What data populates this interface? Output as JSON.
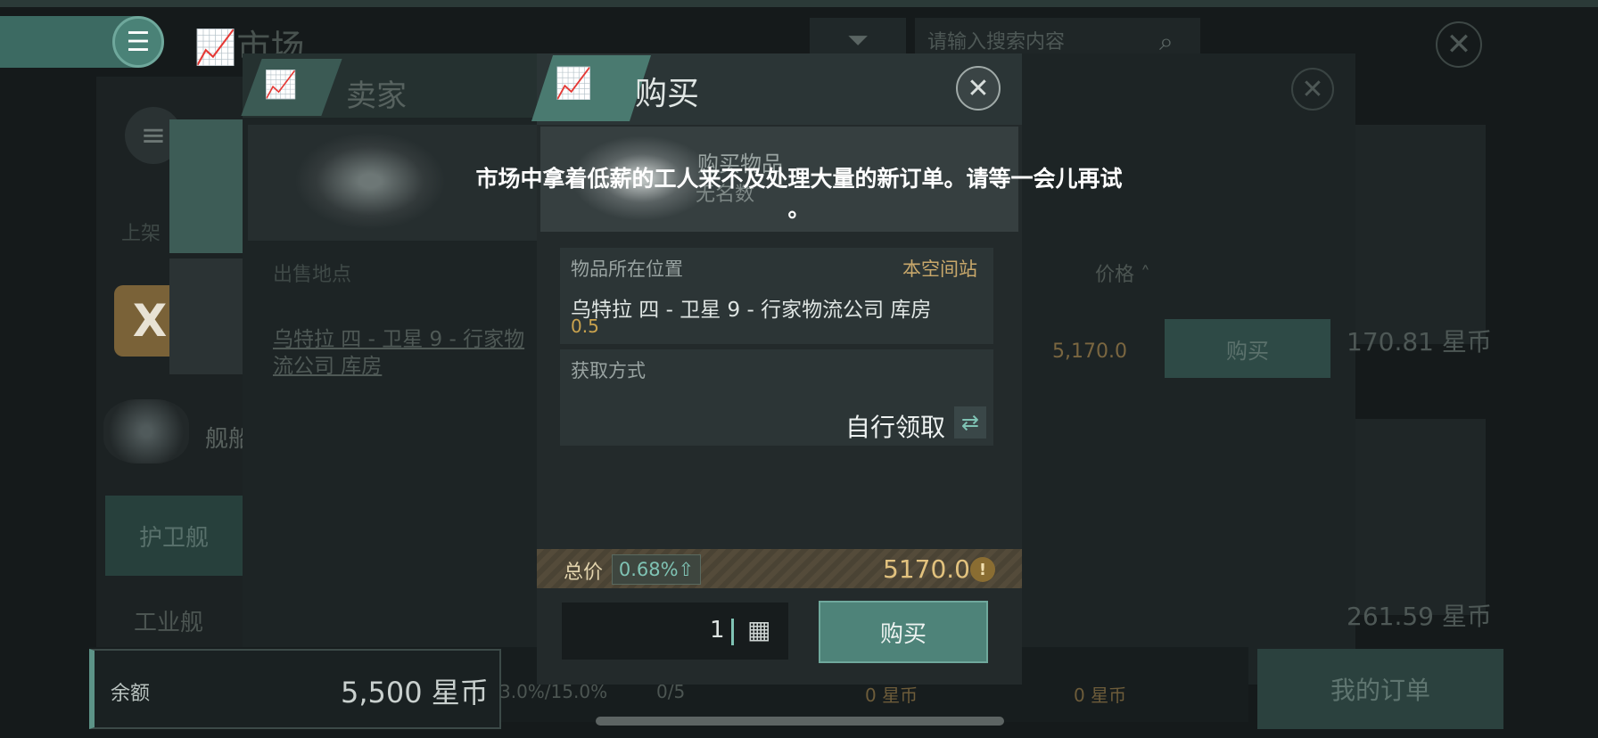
{
  "market": {
    "title": "市场",
    "search_placeholder": "请输入搜索内容",
    "left_panel": {
      "shelf_label": "上架",
      "ship_label": "舰船",
      "escort_label": "护卫舰",
      "industry_label": "工业舰"
    }
  },
  "seller_panel": {
    "title": "卖家",
    "col_location": "出售地点",
    "col_price": "价格",
    "row": {
      "location": "乌特拉 四 - 卫星 9 - 行家物流公司 库房",
      "price": "5,170.0",
      "buy_label": "购买"
    },
    "right_card_prices": [
      "170.81 星币",
      "261.59 星币"
    ]
  },
  "bottom_bar": {
    "balance_label": "余额",
    "balance_value": "5,500 星币",
    "tax_rate": "3.0%/15.0%",
    "slots": "0/5",
    "escrow_a": "0 星币",
    "escrow_b": "0 星币",
    "my_orders": "我的订单"
  },
  "buy_dialog": {
    "title": "购买",
    "item_label": "购买物品",
    "item_sub": "无名数",
    "location_label": "物品所在位置",
    "location_here": "本空间站",
    "location_name": "乌特拉 四 - 卫星 9 - 行家物流公司 库房",
    "security": "0.5",
    "fetch_label": "获取方式",
    "fetch_value": "自行领取",
    "total_label": "总价",
    "total_pct": "0.68%",
    "total_value": "5170.0",
    "quantity": "1",
    "buy_button": "购买"
  },
  "toast": {
    "message": "市场中拿着低薪的工人来不及处理大量的新订单。请等一会儿再试",
    "tail": "。"
  },
  "colors": {
    "accent": "#4e8379",
    "gold": "#e2c27e",
    "security": "#c9a24e",
    "positive": "#7fc3b4"
  },
  "icons": [
    "menu-icon",
    "chart-icon",
    "filter-icon",
    "search-icon",
    "close-icon",
    "calculator-icon",
    "swap-icon",
    "warning-icon",
    "up-arrow-icon"
  ]
}
